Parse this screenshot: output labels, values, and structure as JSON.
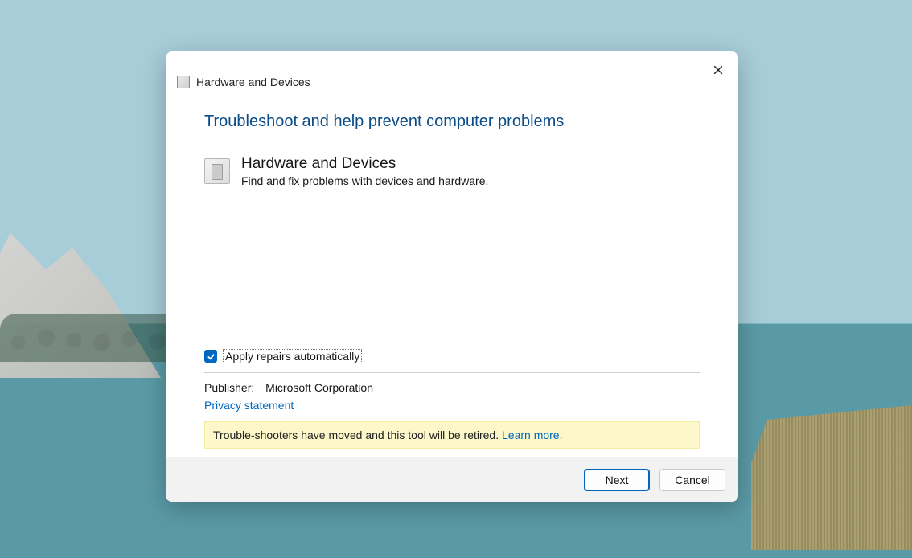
{
  "window": {
    "title": "Hardware and Devices"
  },
  "heading": "Troubleshoot and help prevent computer problems",
  "troubleshooter": {
    "title": "Hardware and Devices",
    "description": "Find and fix problems with devices and hardware."
  },
  "checkbox": {
    "label": "Apply repairs automatically",
    "checked": true
  },
  "publisher": {
    "label": "Publisher:",
    "value": "Microsoft Corporation"
  },
  "privacy_link": "Privacy statement",
  "notice": {
    "text": "Trouble-shooters have moved and this tool will be retired. ",
    "link": "Learn more."
  },
  "buttons": {
    "next_prefix": "N",
    "next_rest": "ext",
    "cancel": "Cancel"
  }
}
